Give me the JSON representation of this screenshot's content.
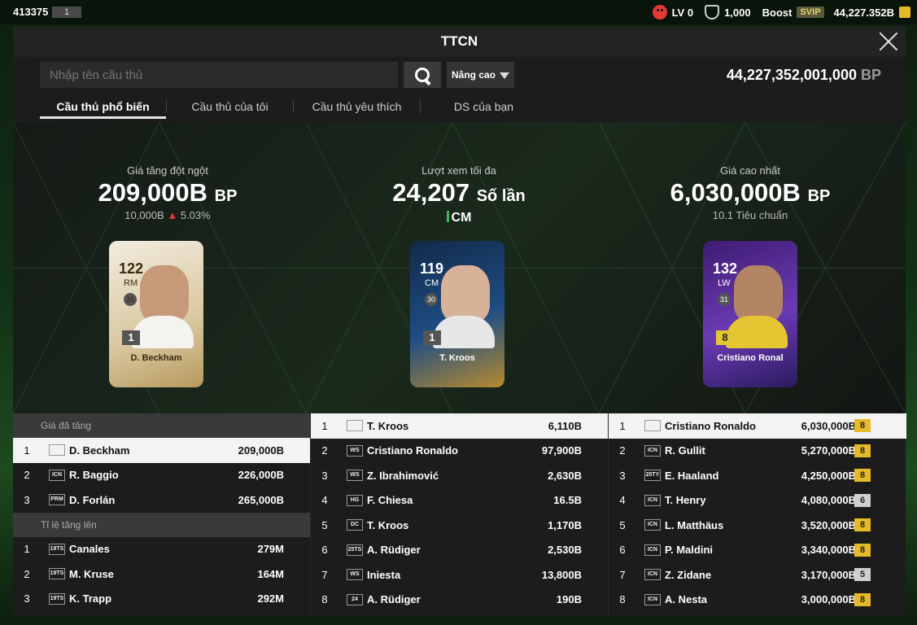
{
  "topbar": {
    "uid": "413375",
    "uid_chip": "1",
    "lv": "LV 0",
    "shield_value": "1,000",
    "boost": "Boost",
    "svip": "SVIP",
    "bp_total": "44,227.352B"
  },
  "modal": {
    "title": "TTCN"
  },
  "search": {
    "placeholder": "Nhập tên cầu thủ",
    "advanced_label": "Nâng cao",
    "balance": "44,227,352,001,000",
    "balance_unit": "BP"
  },
  "tabs": [
    {
      "label": "Cầu thủ phổ biến",
      "active": true
    },
    {
      "label": "Cầu thủ của tôi",
      "active": false
    },
    {
      "label": "Cầu thủ yêu thích",
      "active": false
    },
    {
      "label": "DS của bạn",
      "active": false
    }
  ],
  "highlights": [
    {
      "label": "Giá tăng đột ngột",
      "value": "209,000B",
      "unit": "BP",
      "sub_value": "10,000B",
      "sub_arrow": "▲",
      "sub_pct": "5.03%",
      "card": {
        "ovr": "122",
        "pos": "RM",
        "badge": "31",
        "level": "1",
        "name": "D. Beckham"
      }
    },
    {
      "label": "Lượt xem tối đa",
      "value": "24,207",
      "unit": "Số lần",
      "sub_value": "CM",
      "card": {
        "ovr": "119",
        "pos": "CM",
        "badge": "30",
        "level": "1",
        "name": "T. Kroos"
      }
    },
    {
      "label": "Giá cao nhất",
      "value": "6,030,000B",
      "unit": "BP",
      "sub_value": "10.1 Tiêu chuẩn",
      "card": {
        "ovr": "132",
        "pos": "LW",
        "badge": "31",
        "level": "8",
        "name": "Cristiano Ronal"
      }
    }
  ],
  "panel_left": {
    "section1": "Giá đã tăng",
    "rows1": [
      {
        "rank": "1",
        "icon": "ICN",
        "name": "D. Beckham",
        "price": "209,000B"
      },
      {
        "rank": "2",
        "icon": "ICN",
        "name": "R. Baggio",
        "price": "226,000B"
      },
      {
        "rank": "3",
        "icon": "PRM",
        "name": "D. Forlán",
        "price": "265,000B"
      }
    ],
    "section2": "Tỉ lệ tăng lên",
    "rows2": [
      {
        "rank": "1",
        "icon": "19TS",
        "name": "Canales",
        "price": "279M"
      },
      {
        "rank": "2",
        "icon": "19TS",
        "name": "M. Kruse",
        "price": "164M"
      },
      {
        "rank": "3",
        "icon": "19TS",
        "name": "K. Trapp",
        "price": "292M"
      }
    ]
  },
  "panel_mid": [
    {
      "rank": "1",
      "icon": "WS",
      "name": "T. Kroos",
      "price": "6,110B"
    },
    {
      "rank": "2",
      "icon": "WS",
      "name": "Cristiano Ronaldo",
      "price": "97,900B"
    },
    {
      "rank": "3",
      "icon": "WS",
      "name": "Z. Ibrahimović",
      "price": "2,630B"
    },
    {
      "rank": "4",
      "icon": "HG",
      "name": "F. Chiesa",
      "price": "16.5B"
    },
    {
      "rank": "5",
      "icon": "DC",
      "name": "T. Kroos",
      "price": "1,170B"
    },
    {
      "rank": "6",
      "icon": "25TS",
      "name": "A. Rüdiger",
      "price": "2,530B"
    },
    {
      "rank": "7",
      "icon": "WS",
      "name": "Iniesta",
      "price": "13,800B"
    },
    {
      "rank": "8",
      "icon": "24",
      "name": "A. Rüdiger",
      "price": "190B"
    }
  ],
  "panel_right": [
    {
      "rank": "1",
      "icon": "CU",
      "name": "Cristiano Ronaldo",
      "price": "6,030,000B",
      "level": "8"
    },
    {
      "rank": "2",
      "icon": "ICN",
      "name": "R. Gullit",
      "price": "5,270,000B",
      "level": "8"
    },
    {
      "rank": "3",
      "icon": "25TY",
      "name": "E. Haaland",
      "price": "4,250,000B",
      "level": "8"
    },
    {
      "rank": "4",
      "icon": "ICN",
      "name": "T. Henry",
      "price": "4,080,000B",
      "level": "6"
    },
    {
      "rank": "5",
      "icon": "ICN",
      "name": "L. Matthäus",
      "price": "3,520,000B",
      "level": "8"
    },
    {
      "rank": "6",
      "icon": "ICN",
      "name": "P. Maldini",
      "price": "3,340,000B",
      "level": "8"
    },
    {
      "rank": "7",
      "icon": "ICN",
      "name": "Z. Zidane",
      "price": "3,170,000B",
      "level": "5"
    },
    {
      "rank": "8",
      "icon": "ICN",
      "name": "A. Nesta",
      "price": "3,000,000B",
      "level": "8"
    }
  ]
}
